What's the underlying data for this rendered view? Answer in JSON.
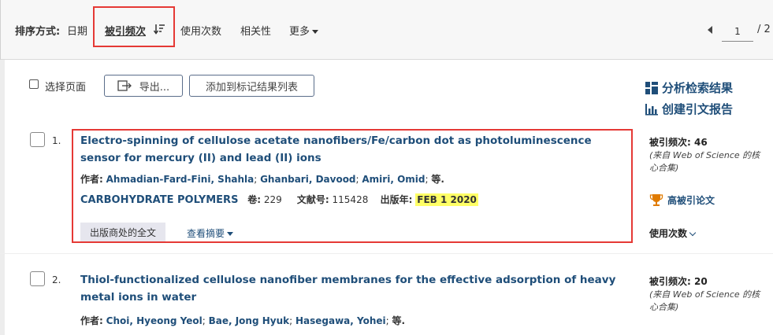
{
  "sort": {
    "label": "排序方式:",
    "options": [
      "日期",
      "被引频次",
      "使用次数",
      "相关性",
      "更多"
    ]
  },
  "pager": {
    "current": "1",
    "total": "/ 2"
  },
  "toolbar": {
    "select_page": "选择页面",
    "export": "导出...",
    "add_to_marked": "添加到标记结果列表"
  },
  "sidebar": {
    "analyze": "分析检索结果",
    "citation_report": "创建引文报告"
  },
  "records": [
    {
      "num": "1.",
      "title": "Electro-spinning of cellulose acetate nanofibers/Fe/carbon dot as photoluminescence sensor for mercury (II) and lead (II) ions",
      "authors_label": "作者:",
      "authors": [
        "Ahmadian-Fard-Fini, Shahla",
        "Ghanbari, Davood",
        "Amiri, Omid"
      ],
      "authors_more": "等.",
      "journal": "CARBOHYDRATE POLYMERS",
      "volume_label": "卷:",
      "volume": "229",
      "article_label": "文献号:",
      "article": "115428",
      "year_label": "出版年:",
      "year": "FEB 1 2020",
      "fulltext": "出版商处的全文",
      "abstract": "查看摘要",
      "cited_label": "被引频次: 46",
      "cited_source": "(来自 Web of Science 的核心合集)",
      "highly_cited": "高被引论文",
      "usage": "使用次数"
    },
    {
      "num": "2.",
      "title": "Thiol-functionalized cellulose nanofiber membranes for the effective adsorption of heavy metal ions in water",
      "authors_label": "作者:",
      "authors": [
        "Choi, Hyeong Yeol",
        "Bae, Jong Hyuk",
        "Hasegawa, Yohei"
      ],
      "authors_more": "等.",
      "cited_label": "被引频次: 20",
      "cited_source": "(来自 Web of Science 的核心合集)"
    }
  ],
  "colors": {
    "link": "#1f4e79",
    "highlight_box": "#e53935",
    "year_highlight": "#ffff66"
  }
}
